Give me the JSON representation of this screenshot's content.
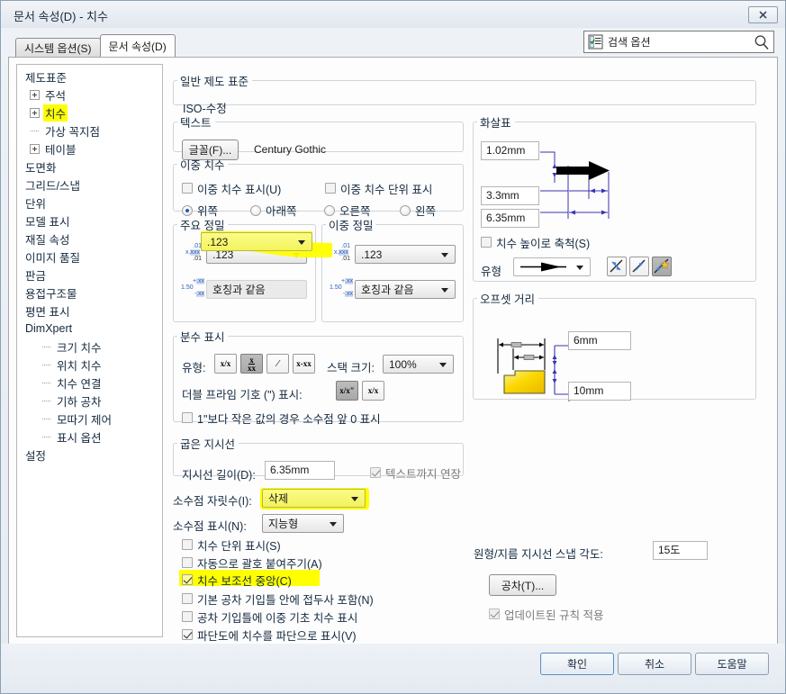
{
  "window": {
    "title": "문서 속성(D) - 치수",
    "close_label": "닫기"
  },
  "tabs": [
    {
      "label": "시스템 옵션(S)",
      "active": false
    },
    {
      "label": "문서 속성(D)",
      "active": true
    }
  ],
  "search": {
    "placeholder": "검색 옵션",
    "value": "검색 옵션",
    "icon": "options-list-icon",
    "search_icon": "magnifier-icon"
  },
  "tree": {
    "items": [
      {
        "label": "제도표준",
        "level": 0,
        "expander": "plus",
        "highlight": false
      },
      {
        "label": "주석",
        "level": 1,
        "expander": "plus",
        "highlight": false
      },
      {
        "label": "치수",
        "level": 1,
        "expander": "plus",
        "highlight": true
      },
      {
        "label": "가상 꼭지점",
        "level": 1,
        "expander": "dots",
        "highlight": false
      },
      {
        "label": "테이블",
        "level": 1,
        "expander": "plus",
        "highlight": false
      },
      {
        "label": "도면화",
        "level": 0,
        "expander": "none",
        "highlight": false
      },
      {
        "label": "그리드/스냅",
        "level": 0,
        "expander": "none",
        "highlight": false
      },
      {
        "label": "단위",
        "level": 0,
        "expander": "none",
        "highlight": false
      },
      {
        "label": "모델 표시",
        "level": 0,
        "expander": "none",
        "highlight": false
      },
      {
        "label": "재질 속성",
        "level": 0,
        "expander": "none",
        "highlight": false
      },
      {
        "label": "이미지 품질",
        "level": 0,
        "expander": "none",
        "highlight": false
      },
      {
        "label": "판금",
        "level": 0,
        "expander": "none",
        "highlight": false
      },
      {
        "label": "용접구조물",
        "level": 0,
        "expander": "none",
        "highlight": false
      },
      {
        "label": "평면 표시",
        "level": 0,
        "expander": "none",
        "highlight": false
      },
      {
        "label": "DimXpert",
        "level": 0,
        "expander": "none",
        "highlight": false
      },
      {
        "label": "크기 치수",
        "level": 2,
        "expander": "dots",
        "highlight": false
      },
      {
        "label": "위치 치수",
        "level": 2,
        "expander": "dots",
        "highlight": false
      },
      {
        "label": "치수 연결",
        "level": 2,
        "expander": "dots",
        "highlight": false
      },
      {
        "label": "기하 공차",
        "level": 2,
        "expander": "dots",
        "highlight": false
      },
      {
        "label": "모따기 제어",
        "level": 2,
        "expander": "dots",
        "highlight": false
      },
      {
        "label": "표시 옵션",
        "level": 2,
        "expander": "dots",
        "highlight": false
      },
      {
        "label": "설정",
        "level": 0,
        "expander": "none",
        "highlight": false
      }
    ]
  },
  "general_standard": {
    "legend": "일반 제도 표준",
    "value": "ISO-수정"
  },
  "text_group": {
    "legend": "텍스트",
    "font_button": "글꼴(F)...",
    "font_name": "Century Gothic"
  },
  "dual_dim": {
    "legend": "이중 치수",
    "show_dual": "이중 치수 표시(U)",
    "show_dual_units": "이중 치수 단위 표시",
    "positions": [
      "위쪽",
      "아래쪽",
      "오른쪽",
      "왼쪽"
    ],
    "selected_position": "위쪽"
  },
  "primary_precision": {
    "legend": "주요 정밀",
    "unit_precision": ".123",
    "tolerance_precision": "호칭과 같음",
    "icon_top": "x.xxx-precision-icon",
    "icon_bottom": "tolerance-precision-icon",
    "highlighted": true
  },
  "dual_precision": {
    "legend": "이중 정밀",
    "unit_precision": ".123",
    "tolerance_precision": "호칭과 같음"
  },
  "fraction": {
    "legend": "분수 표시",
    "type_label": "유형:",
    "type_options": [
      "x/x",
      "x over xx",
      "x slash x",
      "x-xx"
    ],
    "selected_type_index": 1,
    "stack_size_label": "스택 크기:",
    "stack_size_value": "100%",
    "double_prime_label": "더블 프라임 기호 (\") 표시:",
    "double_prime_options": [
      "x/x\"",
      "x/x"
    ],
    "selected_double_prime_index": 0,
    "zero_checkbox": "1\"보다 작은 값의 경우 소수점 앞 0 표시",
    "zero_checked": false
  },
  "bent_leader": {
    "legend": "굽은 지시선",
    "length_label": "지시선 길이(D):",
    "length_value": "6.35mm",
    "extend_label": "텍스트까지 연장",
    "extend_checked": true,
    "extend_disabled": true
  },
  "decimals": {
    "places_label": "소수점 자릿수(I):",
    "places_value": "삭제",
    "places_highlighted": true,
    "display_label": "소수점 표시(N):",
    "display_value": "지능형"
  },
  "checkboxes": [
    {
      "label": "치수 단위 표시(S)",
      "checked": false,
      "highlight": false
    },
    {
      "label": "자동으로 괄호 붙여주기(A)",
      "checked": false,
      "highlight": false
    },
    {
      "label": "치수 보조선 중앙(C)",
      "checked": true,
      "highlight": true
    },
    {
      "label": "기본 공차 기입틀 안에 접두사 포함(N)",
      "checked": false,
      "highlight": false
    },
    {
      "label": "공차 기입틀에 이중 기초 치수 표시",
      "checked": false,
      "highlight": false
    },
    {
      "label": "파단도에 치수를 파단으로 표시(V)",
      "checked": true,
      "highlight": false
    }
  ],
  "arrows": {
    "legend": "화살표",
    "width_value": "1.02mm",
    "height_value": "3.3mm",
    "length_value": "6.35mm",
    "scale_checkbox": "치수 높이로 축척(S)",
    "scale_checked": false,
    "type_label": "유형",
    "type_value": "arrow-filled-preview",
    "attach_buttons": [
      "edge-attach-icon",
      "arrow-attach-icon",
      "face-attach-icon"
    ],
    "selected_attach_index": 2
  },
  "offset": {
    "legend": "오프셋 거리",
    "gap_value": "6mm",
    "extension_value": "10mm"
  },
  "snap": {
    "label": "원형/지름 지시선 스냅 각도:",
    "value": "15도"
  },
  "tolerance_button": {
    "label": "공차(T)..."
  },
  "updated_rules": {
    "label": "업데이트된 규칙 적용",
    "checked": true,
    "disabled": true
  },
  "footer": {
    "ok": "확인",
    "cancel": "취소",
    "help": "도움말"
  }
}
